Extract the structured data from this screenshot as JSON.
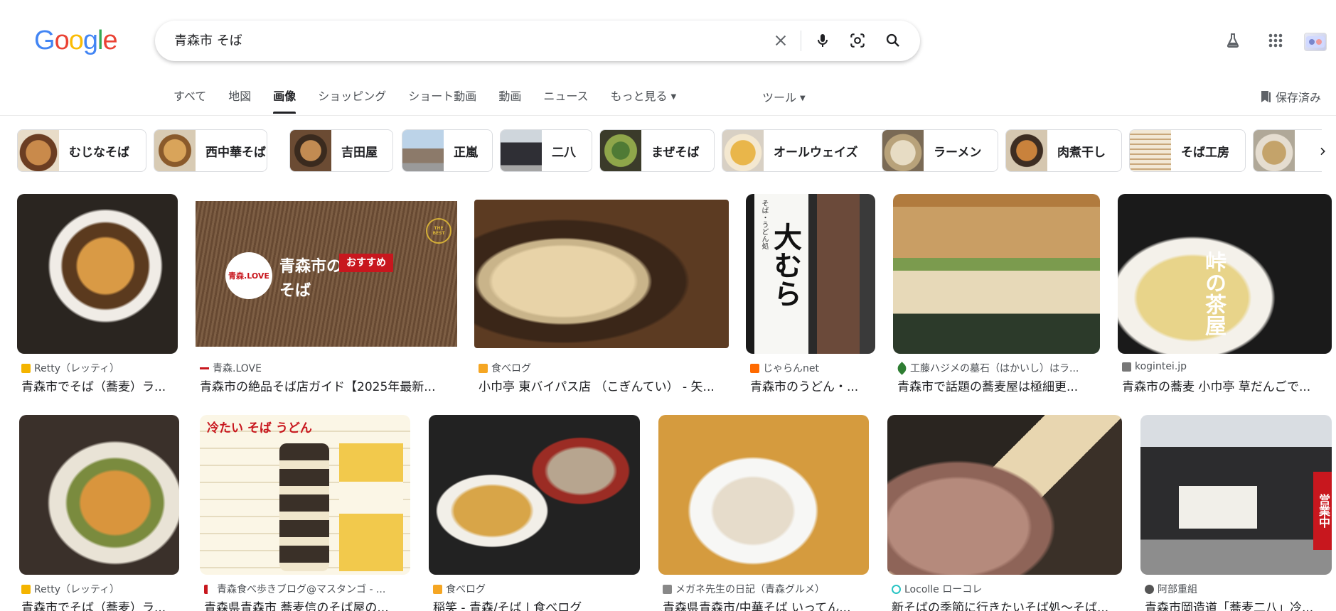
{
  "logo": "Google",
  "search": {
    "query": "青森市 そば"
  },
  "tabs": [
    {
      "label": "すべて"
    },
    {
      "label": "地図"
    },
    {
      "label": "画像"
    },
    {
      "label": "ショッピング"
    },
    {
      "label": "ショート動画"
    },
    {
      "label": "動画"
    },
    {
      "label": "ニュース"
    },
    {
      "label": "もっと見る"
    }
  ],
  "tools_label": "ツール",
  "saved_label": "保存済み",
  "chips": [
    {
      "label": "むじなそば"
    },
    {
      "label": "西中華そば"
    },
    {
      "label": "吉田屋"
    },
    {
      "label": "正嵐"
    },
    {
      "label": "二八"
    },
    {
      "label": "まぜそば"
    },
    {
      "label": "オールウェイズ"
    },
    {
      "label": "ラーメン"
    },
    {
      "label": "肉煮干し"
    },
    {
      "label": "そば工房"
    },
    {
      "label": ""
    }
  ],
  "results": [
    {
      "source": "Retty（レッティ）",
      "title": "青森市でそば（蕎麦）ラ..."
    },
    {
      "source": "青森.LOVE",
      "title": "青森市の絶品そば店ガイド【2025年最新..."
    },
    {
      "source": "食べログ",
      "title": "小巾亭 東バイパス店 （こぎんてい） - 矢..."
    },
    {
      "source": "じゃらんnet",
      "title": "青森市のうどん・..."
    },
    {
      "source": "工藤ハジメの墓石（はかいし）はラ...",
      "title": "青森市で話題の蕎麦屋は極細更..."
    },
    {
      "source": "kogintei.jp",
      "title": "青森市の蕎麦 小巾亭 草だんごで..."
    },
    {
      "source": "Retty（レッティ）",
      "title": "青森市でそば（蕎麦）ラ..."
    },
    {
      "source": "青森食べ歩きブログ@マスタンゴ - ...",
      "title": "青森県青森市 蕎麦信のそば屋の..."
    },
    {
      "source": "食べログ",
      "title": "稲笑 - 青森/そば | 食べログ"
    },
    {
      "source": "メガネ先生の日記（青森グルメ）",
      "title": "青森県青森市/中華そば いってん..."
    },
    {
      "source": "Locolle ローコレ",
      "title": "新そばの季節に行きたいそば処〜そば..."
    },
    {
      "source": "阿部重組",
      "title": "青森市岡造道「蕎麦二八」冷..."
    }
  ],
  "overlay_text": {
    "banner_main": "青森市の",
    "banner_sub": "そば",
    "banner_badge": "おすすめ",
    "banner_logo": "青森.LOVE",
    "banner_best": "THE BEST",
    "sign": "大むら",
    "sign_small": "そば・うどん処",
    "shop": "峠の茶屋",
    "menu_head": "冷たい そば うどん",
    "sale": "営業中"
  },
  "colors": {
    "google_blue": "#4285F4",
    "google_red": "#EA4335",
    "google_yellow": "#FBBC05",
    "google_green": "#34A853",
    "badge_red": "#c8171e"
  }
}
